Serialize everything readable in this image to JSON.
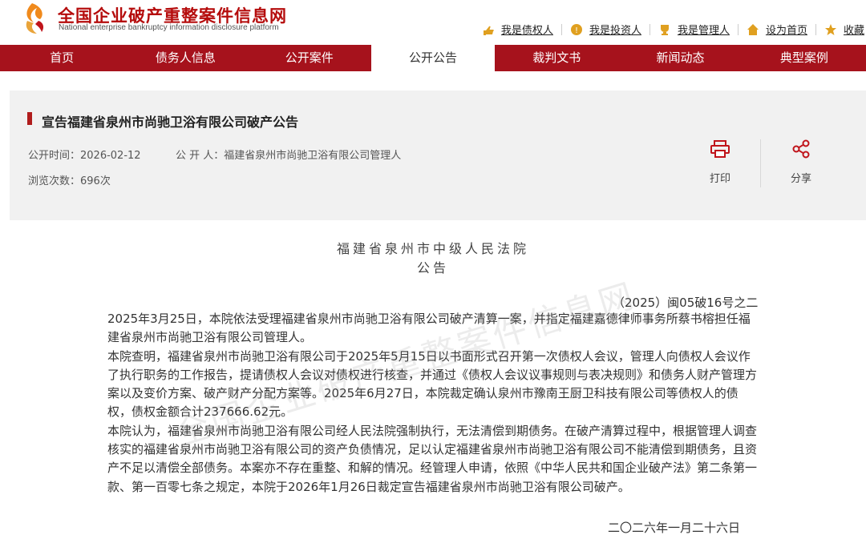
{
  "site": {
    "title": "全国企业破产重整案件信息网",
    "subtitle": "National enterprise bankruptcy information disclosure platform"
  },
  "toplinks": [
    {
      "label": "我是债权人",
      "icon": "hand-icon"
    },
    {
      "label": "我是投资人",
      "icon": "coin-icon"
    },
    {
      "label": "我是管理人",
      "icon": "trophy-icon"
    },
    {
      "label": "设为首页",
      "icon": "home-icon"
    },
    {
      "label": "收藏",
      "icon": "star-icon"
    }
  ],
  "nav": [
    {
      "label": "首页"
    },
    {
      "label": "债务人信息"
    },
    {
      "label": "公开案件"
    },
    {
      "label": "公开公告"
    },
    {
      "label": "裁判文书"
    },
    {
      "label": "新闻动态"
    },
    {
      "label": "典型案例"
    }
  ],
  "nav_active": "公开公告",
  "announcement": {
    "title": "宣告福建省泉州市尚驰卫浴有限公司破产公告",
    "publish_time": "公开时间：2026-02-12",
    "publisher": "公 开 人：福建省泉州市尚驰卫浴有限公司管理人",
    "views": "浏览次数：696次",
    "print_label": "打印",
    "share_label": "分享"
  },
  "document": {
    "court": "福建省泉州市中级人民法院",
    "doc_type": "公告",
    "case_number": "（2025）闽05破16号之二",
    "paragraphs": [
      "2025年3月25日，本院依法受理福建省泉州市尚驰卫浴有限公司破产清算一案，并指定福建嘉德律师事务所蔡书榕担任福建省泉州市尚驰卫浴有限公司管理人。",
      "本院查明，福建省泉州市尚驰卫浴有限公司于2025年5月15日以书面形式召开第一次债权人会议，管理人向债权人会议作了执行职务的工作报告，提请债权人会议对债权进行核查，并通过《债权人会议议事规则与表决规则》和债务人财产管理方案以及变价方案、破产财产分配方案等。2025年6月27日，本院裁定确认泉州市豫南王厨卫科技有限公司等债权人的债权，债权金额合计237666.62元。",
      "本院认为，福建省泉州市尚驰卫浴有限公司经人民法院强制执行，无法清偿到期债务。在破产清算过程中，根据管理人调查核实的福建省泉州市尚驰卫浴有限公司的资产负债情况，足以认定福建省泉州市尚驰卫浴有限公司不能清偿到期债务，且资产不足以清偿全部债务。本案亦不存在重整、和解的情况。经管理人申请，依照《中华人民共和国企业破产法》第二条第一款、第一百零七条之规定，本院于2026年1月26日裁定宣告福建省泉州市尚驰卫浴有限公司破产。"
    ],
    "date": "二〇二六年一月二十六日",
    "watermark": "全国企业破产重整案件信息网"
  },
  "colors": {
    "brand_red": "#a6121c",
    "logo_orange": "#f08a1c"
  }
}
